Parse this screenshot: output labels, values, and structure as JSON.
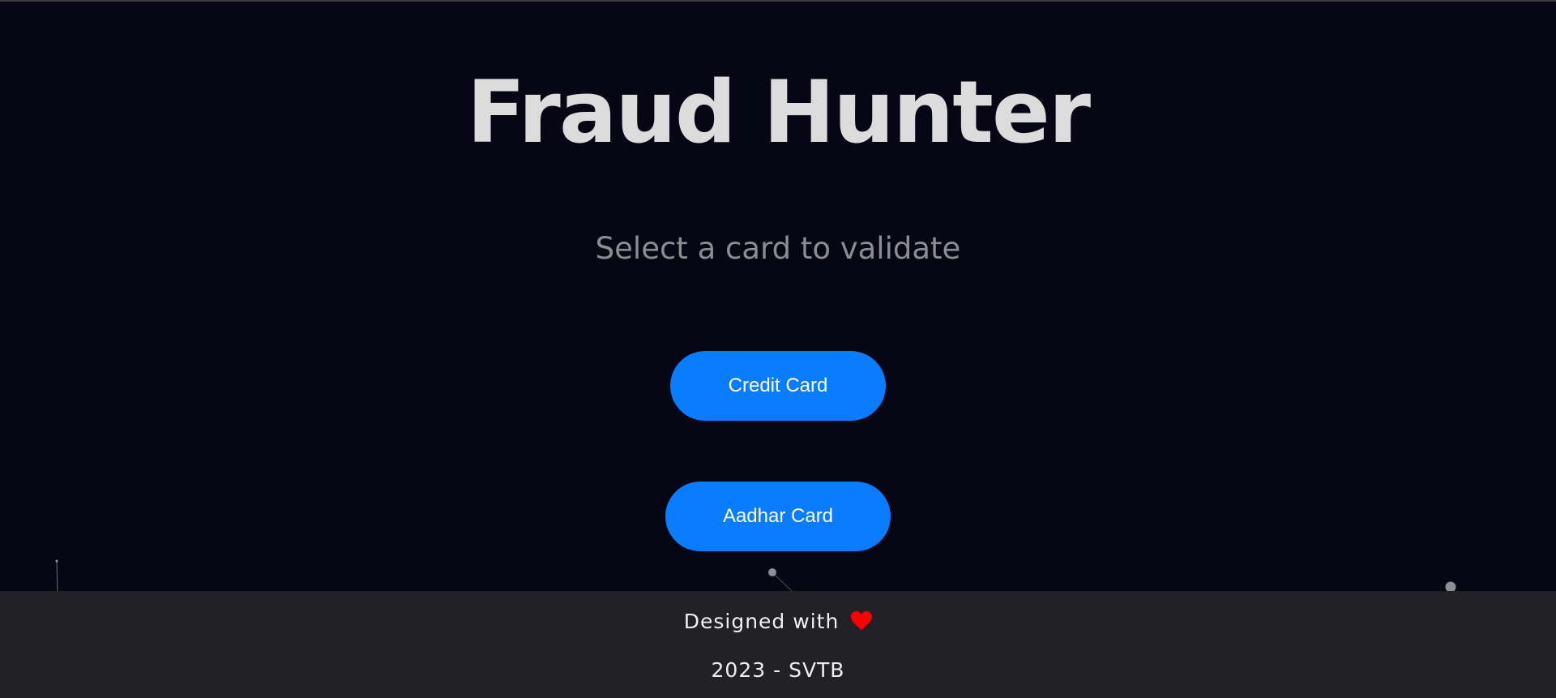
{
  "header": {
    "title": "Fraud Hunter",
    "subtitle": "Select a card to validate"
  },
  "buttons": {
    "credit_card": "Credit Card",
    "aadhar_card": "Aadhar Card"
  },
  "footer": {
    "designed_with": "Designed with",
    "heart_icon": "heart-icon",
    "copyright": "2023 - SVTB"
  },
  "colors": {
    "background": "#070614",
    "button": "#0a7cff",
    "footer": "#222226",
    "heart": "#ff0000"
  }
}
